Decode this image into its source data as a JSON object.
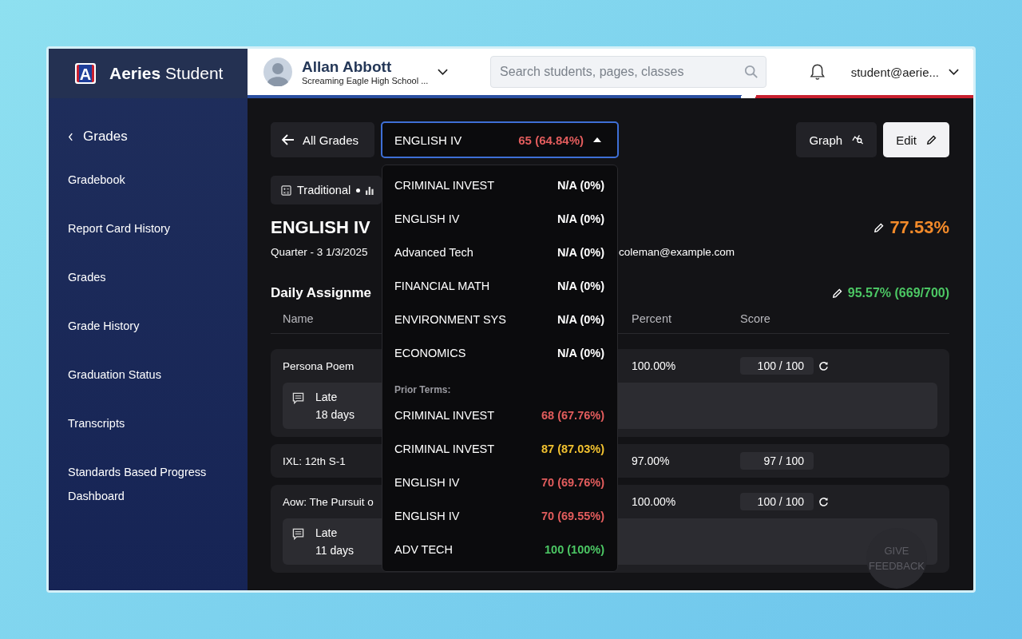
{
  "sidebar": {
    "logo_letter": "A",
    "app_name": "**Aeries** Student",
    "back_label": "Grades",
    "items": [
      {
        "label": "Gradebook"
      },
      {
        "label": "Report Card History"
      },
      {
        "label": "Grades"
      },
      {
        "label": "Grade History"
      },
      {
        "label": "Graduation Status"
      },
      {
        "label": "Transcripts"
      },
      {
        "label": "Standards Based Progress Dashboard"
      }
    ]
  },
  "header": {
    "student_name": "Allan Abbott",
    "school": "Screaming Eagle High School ...",
    "search": {
      "placeholder": "Search students, pages, classes"
    },
    "user": "student@aerie..."
  },
  "toolbar": {
    "back_button": "All Grades",
    "course_select": {
      "course": "ENGLISH IV",
      "grade": "65 (64.84%)",
      "color": "#e35d5d",
      "expanded": true
    },
    "graph_button": "Graph",
    "edit_button": "Edit"
  },
  "view_chip": "Traditional",
  "course": {
    "title": "ENGLISH IV",
    "overall": "77.53%",
    "term": "Quarter - 3 1/3/2025",
    "teacher_email": "coleman@example.com"
  },
  "section": {
    "title": "Daily Assignme",
    "score": "95.57% (669/700)"
  },
  "columns": [
    "Name",
    "Percent",
    "Score"
  ],
  "assignments": [
    {
      "name": "Persona Poem",
      "percent": "100.00%",
      "score": "100 / 100",
      "refresh": true,
      "comment": {
        "status": "Late",
        "detail": "18 days"
      }
    },
    {
      "name": "IXL: 12th S-1",
      "percent": "97.00%",
      "score": "97 / 100",
      "refresh": false
    },
    {
      "name": "Aow: The Pursuit o",
      "percent": "100.00%",
      "score": "100 / 100",
      "refresh": true,
      "comment": {
        "status": "Late",
        "detail": "11 days"
      }
    }
  ],
  "dropdown": {
    "groups": [
      {
        "items": [
          {
            "name": "CRIMINAL INVEST",
            "grade": "N/A (0%)",
            "color": "#ffffff"
          },
          {
            "name": "ENGLISH IV",
            "grade": "N/A (0%)",
            "color": "#ffffff"
          },
          {
            "name": "Advanced Tech",
            "grade": "N/A (0%)",
            "color": "#ffffff"
          },
          {
            "name": "FINANCIAL MATH",
            "grade": "N/A (0%)",
            "color": "#ffffff"
          },
          {
            "name": "ENVIRONMENT SYS",
            "grade": "N/A (0%)",
            "color": "#ffffff"
          },
          {
            "name": "ECONOMICS",
            "grade": "N/A (0%)",
            "color": "#ffffff"
          }
        ]
      },
      {
        "heading": "Prior Terms:",
        "items": [
          {
            "name": "CRIMINAL INVEST",
            "grade": "68 (67.76%)",
            "color": "#e35d5d"
          },
          {
            "name": "CRIMINAL INVEST",
            "grade": "87 (87.03%)",
            "color": "#f2c230"
          },
          {
            "name": "ENGLISH IV",
            "grade": "70 (69.76%)",
            "color": "#e35d5d"
          },
          {
            "name": "ENGLISH IV",
            "grade": "70 (69.55%)",
            "color": "#e35d5d"
          },
          {
            "name": "ADV TECH",
            "grade": "100 (100%)",
            "color": "#4cc764"
          }
        ]
      }
    ]
  },
  "feedback_button": "GIVE FEEDBACK"
}
